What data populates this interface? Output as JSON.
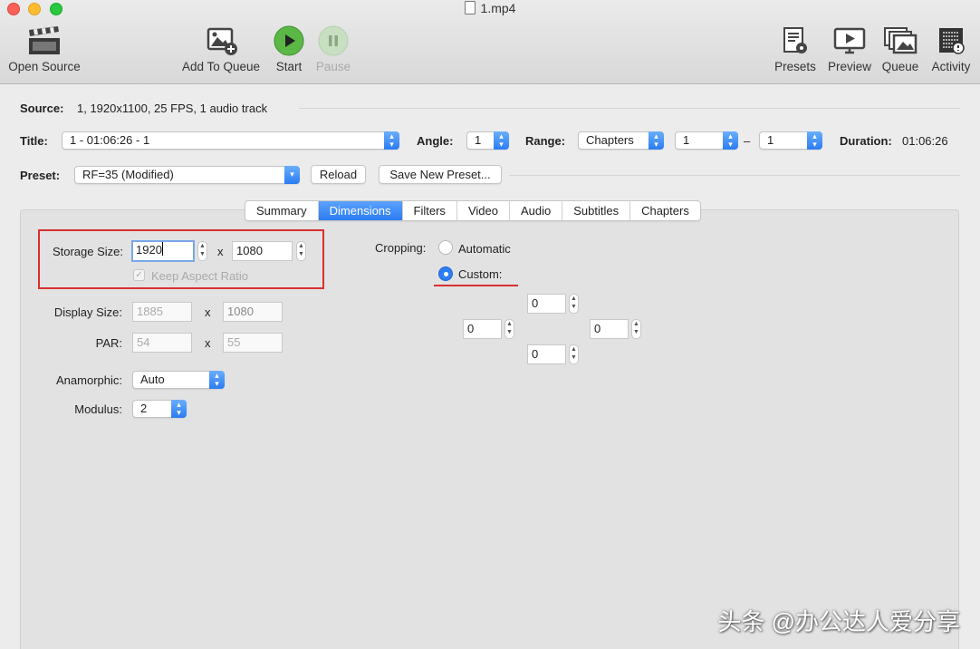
{
  "window": {
    "title": "1.mp4"
  },
  "toolbar": {
    "open_source": "Open Source",
    "add_to_queue": "Add To Queue",
    "start": "Start",
    "pause": "Pause",
    "presets": "Presets",
    "preview": "Preview",
    "queue": "Queue",
    "activity": "Activity"
  },
  "source": {
    "label": "Source:",
    "value": "1, 1920x1100, 25 FPS, 1 audio track"
  },
  "title_row": {
    "title_label": "Title:",
    "title_value": "1 - 01:06:26 - 1",
    "angle_label": "Angle:",
    "angle_value": "1",
    "range_label": "Range:",
    "range_value": "Chapters",
    "range_start": "1",
    "range_sep": "–",
    "range_end": "1",
    "duration_label": "Duration:",
    "duration_value": "01:06:26"
  },
  "preset_row": {
    "label": "Preset:",
    "value": "RF=35 (Modified)",
    "reload": "Reload",
    "save_new": "Save New Preset..."
  },
  "tabs": [
    "Summary",
    "Dimensions",
    "Filters",
    "Video",
    "Audio",
    "Subtitles",
    "Chapters"
  ],
  "selected_tab": "Dimensions",
  "dimensions": {
    "storage_label": "Storage Size:",
    "storage_width": "1920",
    "storage_height": "1080",
    "x": "x",
    "keep_aspect": "Keep Aspect Ratio",
    "display_label": "Display Size:",
    "display_width": "1885",
    "display_height": "1080",
    "par_label": "PAR:",
    "par_width": "54",
    "par_height": "55",
    "anamorphic_label": "Anamorphic:",
    "anamorphic_value": "Auto",
    "modulus_label": "Modulus:",
    "modulus_value": "2"
  },
  "cropping": {
    "label": "Cropping:",
    "automatic": "Automatic",
    "custom": "Custom:",
    "top": "0",
    "left": "0",
    "right": "0",
    "bottom": "0"
  },
  "watermark": "头条 @办公达人爱分享",
  "colors": {
    "accent": "#2c7cf2",
    "highlight_box": "#d93030"
  }
}
